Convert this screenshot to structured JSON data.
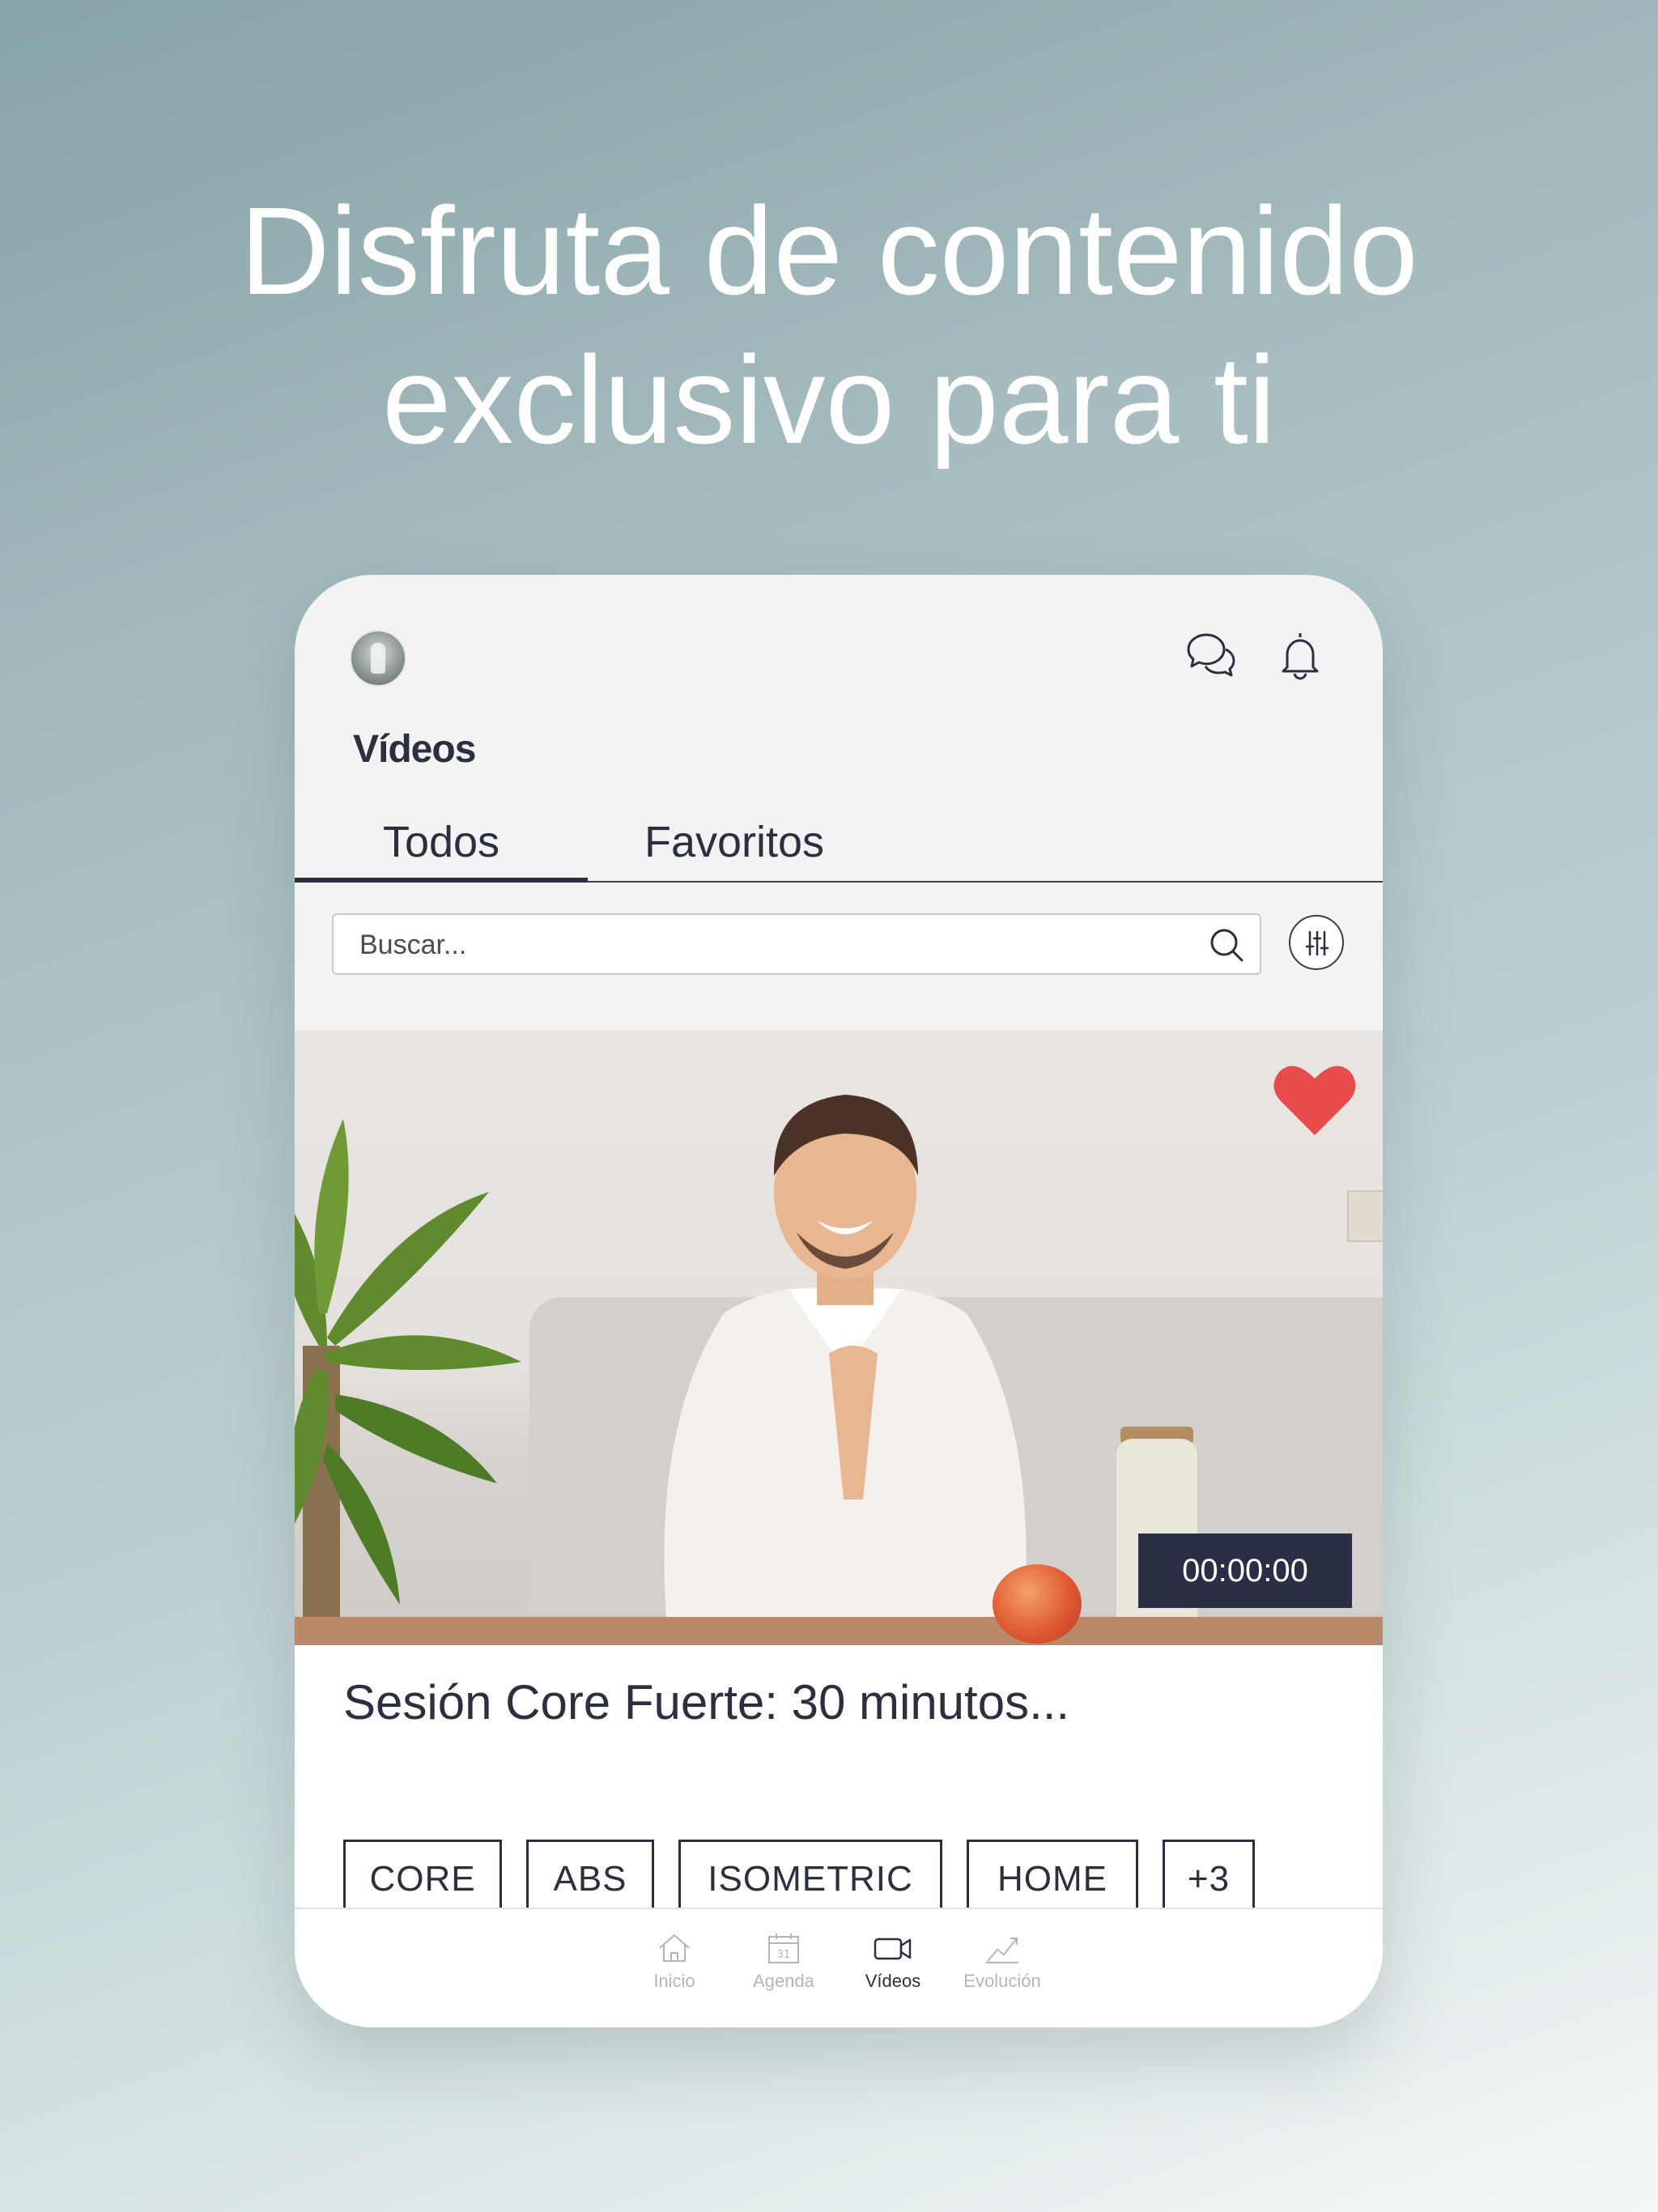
{
  "headline": {
    "line1": "Disfruta de contenido",
    "line2": "exclusivo para ti"
  },
  "app": {
    "header": {
      "avatar_icon": "profile-avatar",
      "chat_icon": "chat-bubbles-icon",
      "bell_icon": "bell-icon"
    },
    "section_title": "Vídeos",
    "tabs": [
      {
        "label": "Todos",
        "active": true
      },
      {
        "label": "Favoritos",
        "active": false
      }
    ],
    "search": {
      "placeholder": "Buscar...",
      "value": ""
    },
    "video_card": {
      "duration": "00:00:00",
      "favorite": true,
      "title": "Sesión Core Fuerte: 30 minutos...",
      "tags": [
        "CORE",
        "ABS",
        "ISOMETRIC",
        "HOME",
        "+3"
      ]
    },
    "bottom_nav": [
      {
        "label": "Inicio",
        "icon": "home-icon",
        "active": false
      },
      {
        "label": "Agenda",
        "icon": "calendar-icon",
        "active": false
      },
      {
        "label": "Vídeos",
        "icon": "video-camera-icon",
        "active": true
      },
      {
        "label": "Evolución",
        "icon": "trend-chart-icon",
        "active": false
      }
    ],
    "colors": {
      "accent_dark": "#2b2f3e",
      "heart": "#e84b4b",
      "duration_bg": "#2b2f45"
    }
  }
}
